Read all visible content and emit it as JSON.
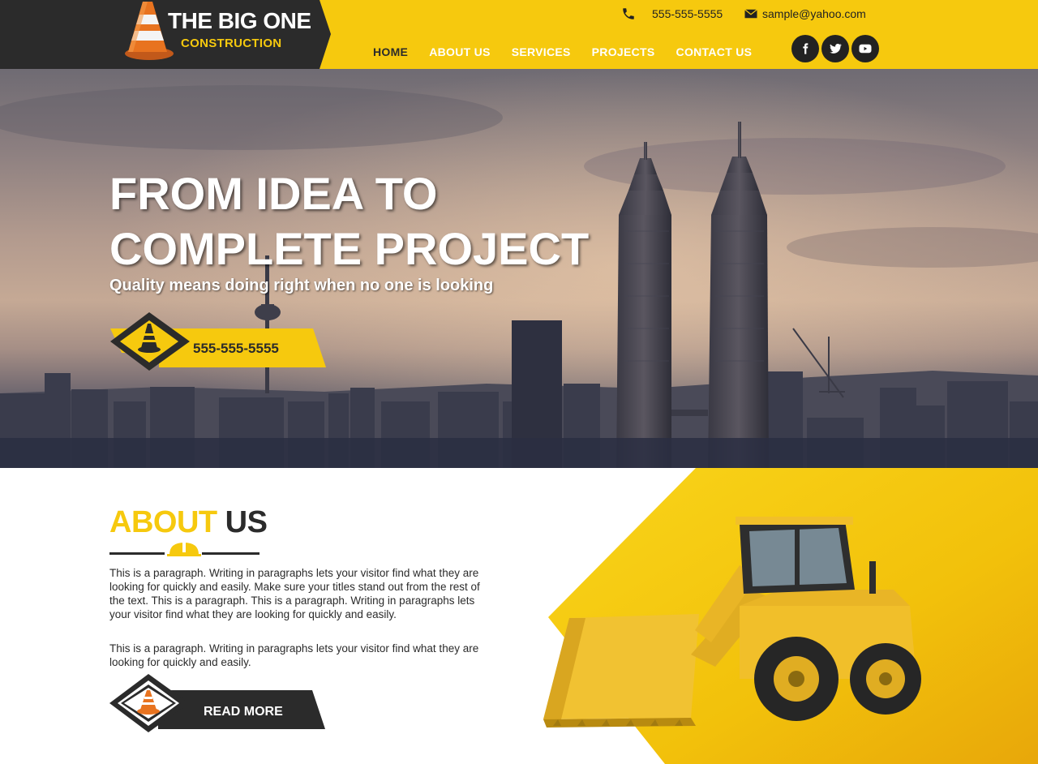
{
  "brand": {
    "title": "THE BIG ONE",
    "subtitle": "CONSTRUCTION"
  },
  "header": {
    "phone": "555-555-5555",
    "email": "sample@yahoo.com",
    "nav": [
      {
        "label": "HOME",
        "active": true
      },
      {
        "label": "ABOUT US",
        "active": false
      },
      {
        "label": "SERVICES",
        "active": false
      },
      {
        "label": "PROJECTS",
        "active": false
      },
      {
        "label": "CONTACT US",
        "active": false
      }
    ],
    "social": [
      "facebook-icon",
      "twitter-icon",
      "youtube-icon"
    ]
  },
  "hero": {
    "title_line1": "FROM IDEA TO",
    "title_line2": "COMPLETE PROJECT",
    "tagline": "Quality means doing right when no one is looking",
    "phone": "555-555-5555"
  },
  "about": {
    "title_highlight": "ABOUT",
    "title_rest": "US",
    "paragraph1": "This is a paragraph. Writing in paragraphs lets your visitor find what they are looking for quickly and easily. Make sure your titles stand out from the rest of the text. This is a paragraph. This is a paragraph. Writing in paragraphs lets your visitor find what they are looking for quickly and easily.",
    "paragraph2": "This is a paragraph. Writing in paragraphs lets your visitor find what they are looking for quickly and easily.",
    "button_label": "READ MORE"
  },
  "colors": {
    "accent": "#f6c90e",
    "dark": "#2b2b2b",
    "white": "#ffffff"
  }
}
